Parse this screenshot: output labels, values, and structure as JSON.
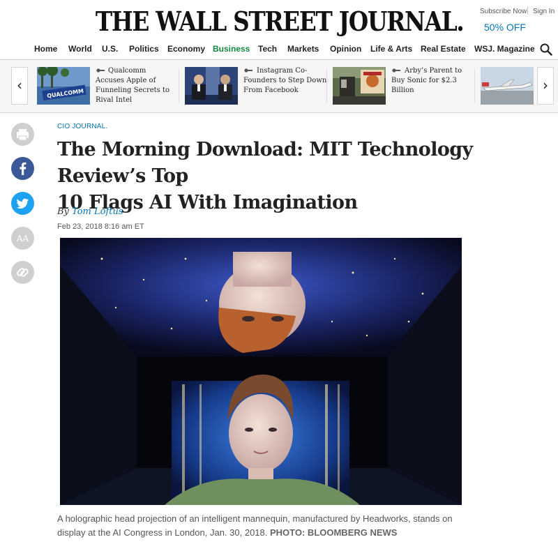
{
  "masthead": {
    "logo": "THE WALL STREET JOURNAL.",
    "subscribe": "Subscribe Now",
    "separator": "|",
    "signin": "Sign In",
    "offer": "50% OFF"
  },
  "nav": {
    "items": [
      {
        "label": "Home"
      },
      {
        "label": "World"
      },
      {
        "label": "U.S."
      },
      {
        "label": "Politics"
      },
      {
        "label": "Economy"
      },
      {
        "label": "Business",
        "active": true
      },
      {
        "label": "Tech"
      },
      {
        "label": "Markets"
      },
      {
        "label": "Opinion"
      },
      {
        "label": "Life & Arts"
      },
      {
        "label": "Real Estate"
      },
      {
        "label": "WSJ. Magazine"
      }
    ],
    "search_icon": "search-icon",
    "active_color": "#0f8a3d"
  },
  "strip": {
    "prev_arrow": "‹",
    "next_arrow": "›",
    "stories": [
      {
        "lines": [
          "Qualcomm",
          "Accuses Apple of",
          "Funneling Secrets to",
          "Rival Intel"
        ],
        "thumb_text": "QUALCOMM"
      },
      {
        "lines": [
          "Instagram Co-",
          "Founders to Step Down",
          "From Facebook"
        ]
      },
      {
        "lines": [
          "Arby’s Parent to",
          "Buy Sonic for $2.3",
          "Billion"
        ]
      },
      {
        "lines": []
      }
    ]
  },
  "share": {
    "icons": [
      "print-icon",
      "facebook-icon",
      "twitter-icon",
      "text-size-icon",
      "link-icon"
    ],
    "text_size_label": "AA",
    "facebook_color": "#3b5998",
    "twitter_color": "#1da1f2"
  },
  "article": {
    "flashline": "CIO JOURNAL.",
    "headline_lines": [
      "The Morning Download: MIT Technology Review’s Top",
      "10 Flags AI With Imagination"
    ],
    "byline_prefix": "By",
    "author": "Tom Loftus",
    "timestamp": "Feb 23, 2018 8:16 am ET",
    "caption": "A holographic head projection of an intelligent mannequin, manufactured by Headworks, stands on display at the AI Congress in London, Jan. 30, 2018.",
    "caption_credit": "PHOTO: BLOOMBERG NEWS",
    "link_color": "#0274b6"
  }
}
